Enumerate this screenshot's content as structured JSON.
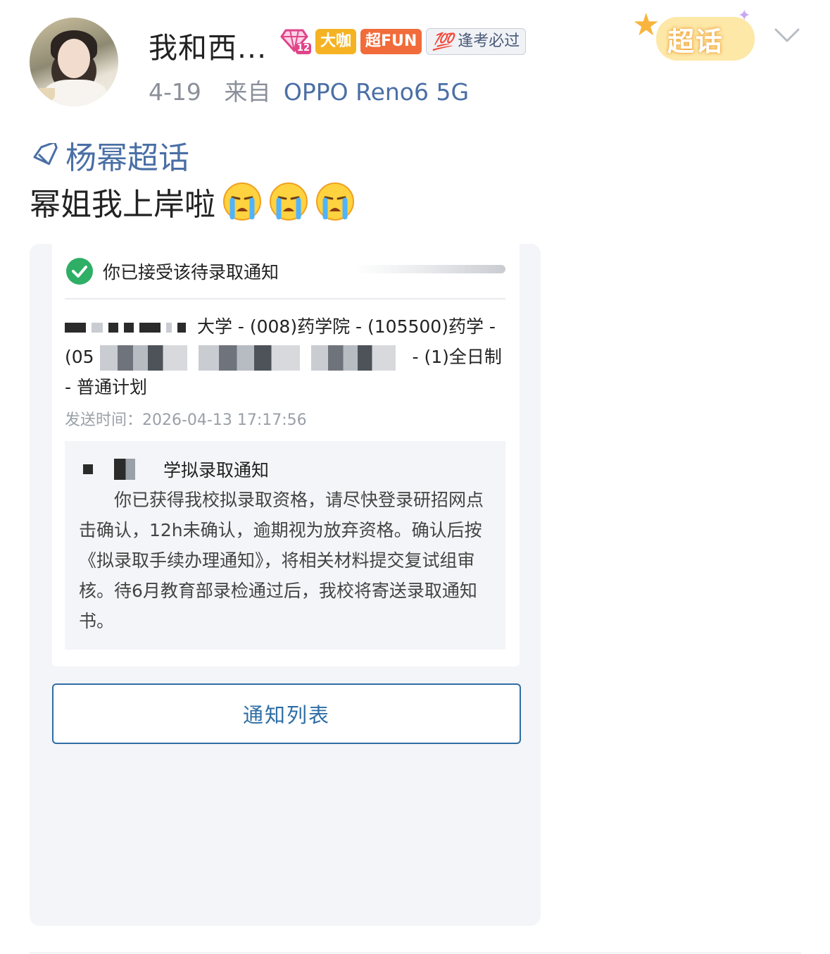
{
  "post": {
    "username": "我和西...",
    "badges": {
      "level": "12",
      "daka": "大咖",
      "fun": "超FUN",
      "kaoshi_num": "💯",
      "kaoshi_text": "逢考必过"
    },
    "date": "4-19",
    "from_label": "来自",
    "device": "OPPO Reno6 5G",
    "supertopic_badge": "超话",
    "topic": "杨幂超话",
    "text": "幂姐我上岸啦"
  },
  "screenshot": {
    "accept_text": "你已接受该待录取通知",
    "program_line1": "大学 - (008)药学院 - (105500)药学 -",
    "program_line2_prefix": "(05",
    "program_line2_suffix": "- (1)全日制",
    "program_line3": "- 普通计划",
    "send_time": "发送时间：2026-04-13 17:17:56",
    "notice_title": "学拟录取通知",
    "notice_body": "你已获得我校拟录取资格，请尽快登录研招网点击确认，12h未确认，逾期视为放弃资格。确认后按《拟录取手续办理通知》，将相关材料提交复试组审核。待6月教育部录检通过后，我校将寄送录取通知书。",
    "notify_button": "通知列表"
  },
  "colors": {
    "link": "#4a6fa5",
    "accept_green": "#2fae66",
    "button_blue": "#2e6da4"
  }
}
